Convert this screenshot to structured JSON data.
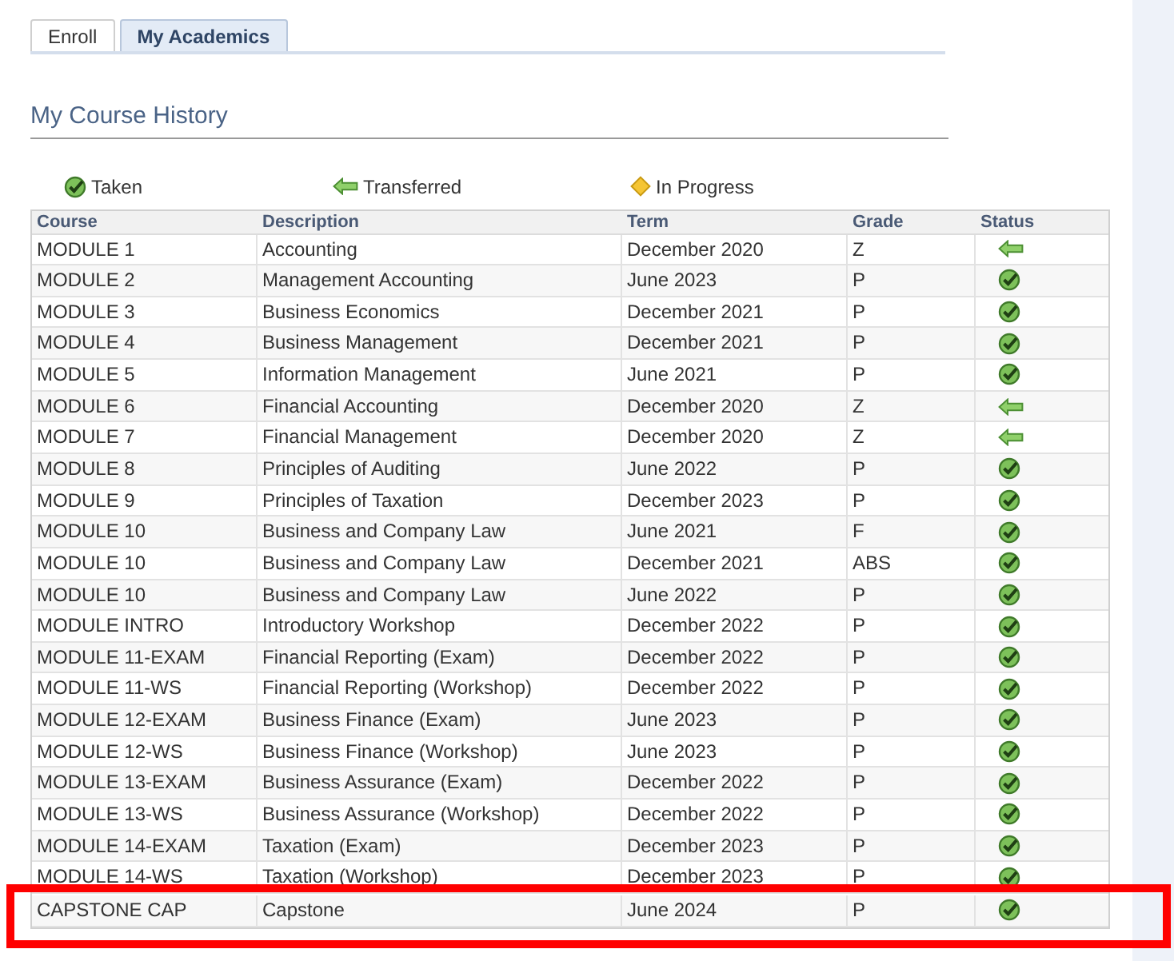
{
  "tabs": [
    {
      "label": "Enroll",
      "selected": false
    },
    {
      "label": "My Academics",
      "selected": true
    }
  ],
  "heading": "My Course History",
  "legend": [
    {
      "kind": "taken",
      "label": "Taken"
    },
    {
      "kind": "transferred",
      "label": "Transferred"
    },
    {
      "kind": "in_progress",
      "label": "In Progress"
    }
  ],
  "table": {
    "columns": [
      "Course",
      "Description",
      "Term",
      "Grade",
      "Status"
    ],
    "rows": [
      {
        "course": "MODULE 1",
        "description": "Accounting",
        "term": "December 2020",
        "grade": "Z",
        "kind": "transferred"
      },
      {
        "course": "MODULE 2",
        "description": "Management Accounting",
        "term": "June 2023",
        "grade": "P",
        "kind": "taken"
      },
      {
        "course": "MODULE 3",
        "description": "Business Economics",
        "term": "December 2021",
        "grade": "P",
        "kind": "taken"
      },
      {
        "course": "MODULE 4",
        "description": "Business Management",
        "term": "December 2021",
        "grade": "P",
        "kind": "taken"
      },
      {
        "course": "MODULE 5",
        "description": "Information Management",
        "term": "June 2021",
        "grade": "P",
        "kind": "taken"
      },
      {
        "course": "MODULE 6",
        "description": "Financial Accounting",
        "term": "December 2020",
        "grade": "Z",
        "kind": "transferred"
      },
      {
        "course": "MODULE 7",
        "description": "Financial Management",
        "term": "December 2020",
        "grade": "Z",
        "kind": "transferred"
      },
      {
        "course": "MODULE 8",
        "description": "Principles of Auditing",
        "term": "June 2022",
        "grade": "P",
        "kind": "taken"
      },
      {
        "course": "MODULE 9",
        "description": "Principles of Taxation",
        "term": "December 2023",
        "grade": "P",
        "kind": "taken"
      },
      {
        "course": "MODULE 10",
        "description": "Business and Company Law",
        "term": "June 2021",
        "grade": "F",
        "kind": "taken"
      },
      {
        "course": "MODULE 10",
        "description": "Business and Company Law",
        "term": "December 2021",
        "grade": "ABS",
        "kind": "taken"
      },
      {
        "course": "MODULE 10",
        "description": "Business and Company Law",
        "term": "June 2022",
        "grade": "P",
        "kind": "taken"
      },
      {
        "course": "MODULE INTRO",
        "description": "Introductory Workshop",
        "term": "December 2022",
        "grade": "P",
        "kind": "taken"
      },
      {
        "course": "MODULE 11-EXAM",
        "description": "Financial Reporting (Exam)",
        "term": "December 2022",
        "grade": "P",
        "kind": "taken"
      },
      {
        "course": "MODULE 11-WS",
        "description": "Financial Reporting (Workshop)",
        "term": "December 2022",
        "grade": "P",
        "kind": "taken"
      },
      {
        "course": "MODULE 12-EXAM",
        "description": "Business Finance (Exam)",
        "term": "June 2023",
        "grade": "P",
        "kind": "taken"
      },
      {
        "course": "MODULE 12-WS",
        "description": "Business Finance (Workshop)",
        "term": "June 2023",
        "grade": "P",
        "kind": "taken"
      },
      {
        "course": "MODULE 13-EXAM",
        "description": "Business Assurance (Exam)",
        "term": "December 2022",
        "grade": "P",
        "kind": "taken"
      },
      {
        "course": "MODULE 13-WS",
        "description": "Business Assurance (Workshop)",
        "term": "December 2022",
        "grade": "P",
        "kind": "taken"
      },
      {
        "course": "MODULE 14-EXAM",
        "description": "Taxation (Exam)",
        "term": "December 2023",
        "grade": "P",
        "kind": "taken"
      },
      {
        "course": "MODULE 14-WS",
        "description": "Taxation (Workshop)",
        "term": "December 2023",
        "grade": "P",
        "kind": "taken"
      },
      {
        "course": "CAPSTONE CAP",
        "description": "Capstone",
        "term": "June 2024",
        "grade": "P",
        "kind": "taken"
      }
    ]
  }
}
